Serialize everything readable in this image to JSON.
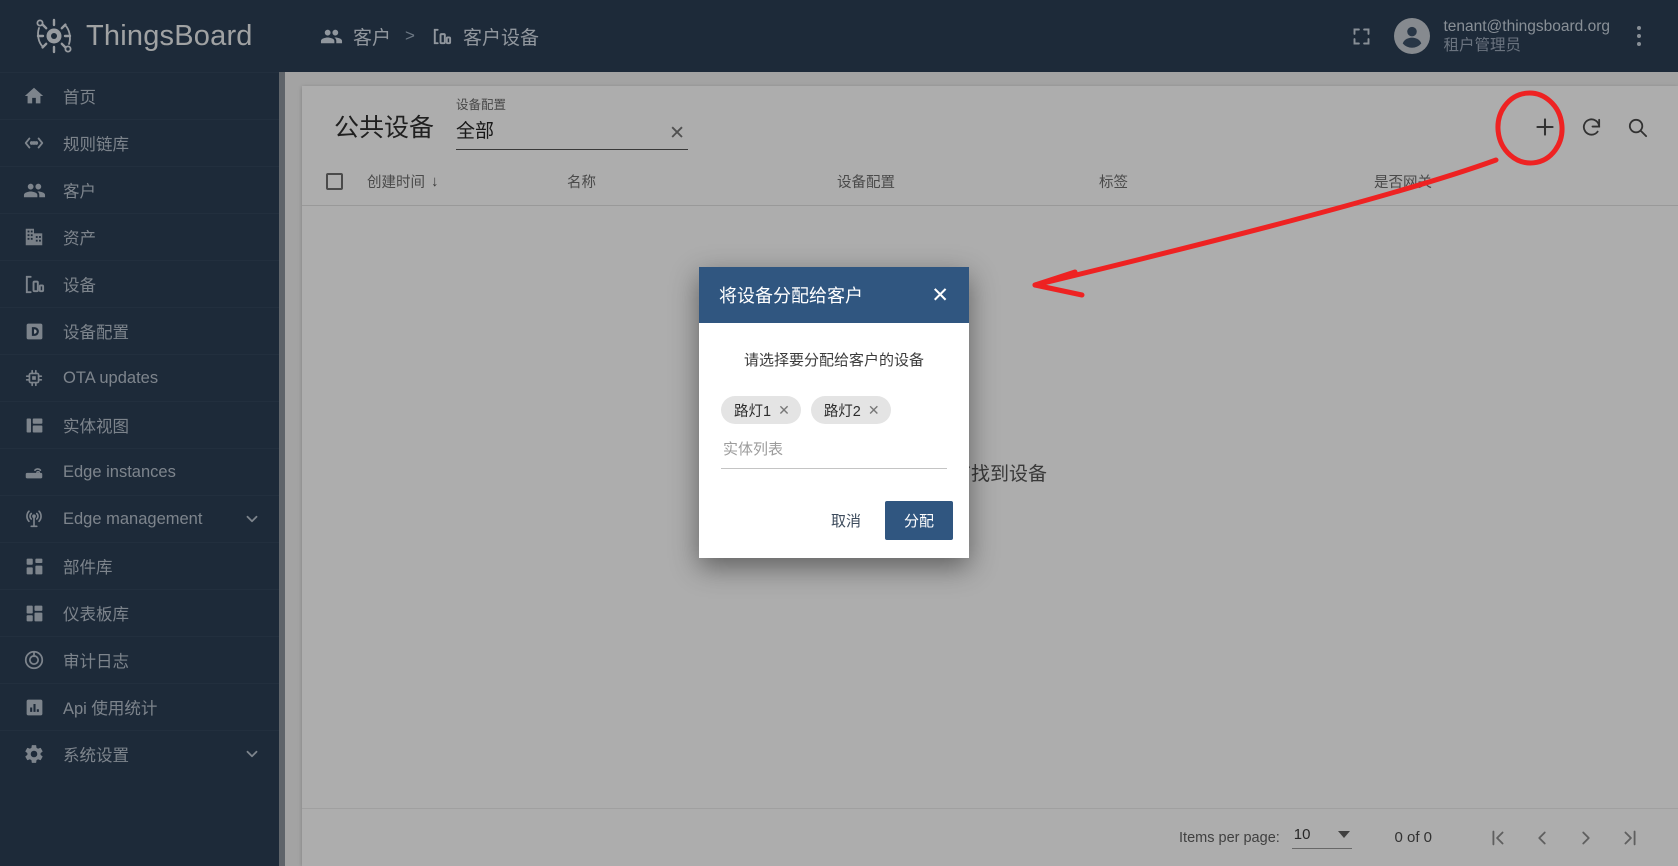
{
  "brand": {
    "name": "ThingsBoard",
    "logo_icon": "thingsboard-gear-logo",
    "sidebar_bg": "#2b3e54"
  },
  "sidebar": {
    "items": [
      {
        "label": "首页",
        "icon": "home-icon",
        "expandable": false
      },
      {
        "label": "规则链库",
        "icon": "rule-chain-icon",
        "expandable": false
      },
      {
        "label": "客户",
        "icon": "customers-icon",
        "expandable": false
      },
      {
        "label": "资产",
        "icon": "assets-icon",
        "expandable": false
      },
      {
        "label": "设备",
        "icon": "devices-icon",
        "expandable": false
      },
      {
        "label": "设备配置",
        "icon": "device-profiles-icon",
        "expandable": false
      },
      {
        "label": "OTA updates",
        "icon": "ota-updates-icon",
        "expandable": false
      },
      {
        "label": "实体视图",
        "icon": "entity-views-icon",
        "expandable": false
      },
      {
        "label": "Edge instances",
        "icon": "edge-instances-icon",
        "expandable": false
      },
      {
        "label": "Edge management",
        "icon": "edge-management-icon",
        "expandable": true
      },
      {
        "label": "部件库",
        "icon": "widgets-library-icon",
        "expandable": false
      },
      {
        "label": "仪表板库",
        "icon": "dashboards-icon",
        "expandable": false
      },
      {
        "label": "审计日志",
        "icon": "audit-logs-icon",
        "expandable": false
      },
      {
        "label": "Api 使用统计",
        "icon": "api-usage-icon",
        "expandable": false
      },
      {
        "label": "系统设置",
        "icon": "settings-gear-icon",
        "expandable": true
      }
    ]
  },
  "topbar": {
    "breadcrumb": [
      {
        "label": "客户",
        "icon": "customers-icon"
      },
      {
        "label": "客户设备",
        "icon": "devices-icon"
      }
    ],
    "separator": ">",
    "fullscreen_icon": "fullscreen-icon",
    "avatar_icon": "user-avatar-icon",
    "user_email": "tenant@thingsboard.org",
    "user_role": "租户管理员",
    "kebab_icon": "more-vertical-icon"
  },
  "card": {
    "title": "公共设备",
    "filter": {
      "label": "设备配置",
      "value": "全部",
      "clear_icon": "close-icon"
    },
    "actions": [
      {
        "name": "add-device-button",
        "icon": "plus-icon"
      },
      {
        "name": "refresh-button",
        "icon": "refresh-icon"
      },
      {
        "name": "search-button",
        "icon": "search-icon"
      }
    ],
    "columns": [
      {
        "key": "created",
        "label": "创建时间",
        "sorted": true,
        "sort_arrow": "↓"
      },
      {
        "key": "name",
        "label": "名称"
      },
      {
        "key": "profile",
        "label": "设备配置"
      },
      {
        "key": "label",
        "label": "标签"
      },
      {
        "key": "gateway",
        "label": "是否网关"
      }
    ],
    "rows": [],
    "empty_message": "没有找到设备"
  },
  "paginator": {
    "items_per_page_label": "Items per page:",
    "items_per_page_value": "10",
    "range_label": "0 of 0",
    "buttons": [
      {
        "name": "first-page-button",
        "icon": "first-page-icon"
      },
      {
        "name": "previous-page-button",
        "icon": "chevron-left-icon"
      },
      {
        "name": "next-page-button",
        "icon": "chevron-right-icon"
      },
      {
        "name": "last-page-button",
        "icon": "last-page-icon"
      }
    ]
  },
  "dialog": {
    "title": "将设备分配给客户",
    "close_icon": "close-icon",
    "prompt": "请选择要分配给客户的设备",
    "chips": [
      {
        "label": "路灯1",
        "remove_icon": "close-icon"
      },
      {
        "label": "路灯2",
        "remove_icon": "close-icon"
      }
    ],
    "input_placeholder": "实体列表",
    "input_value": "",
    "cancel_label": "取消",
    "confirm_label": "分配",
    "header_color": "#305680"
  },
  "annotations": {
    "color": "#ee2222",
    "circle_target": "add-device-button",
    "arrow": "points-from-dialog-area-to-add-button"
  }
}
